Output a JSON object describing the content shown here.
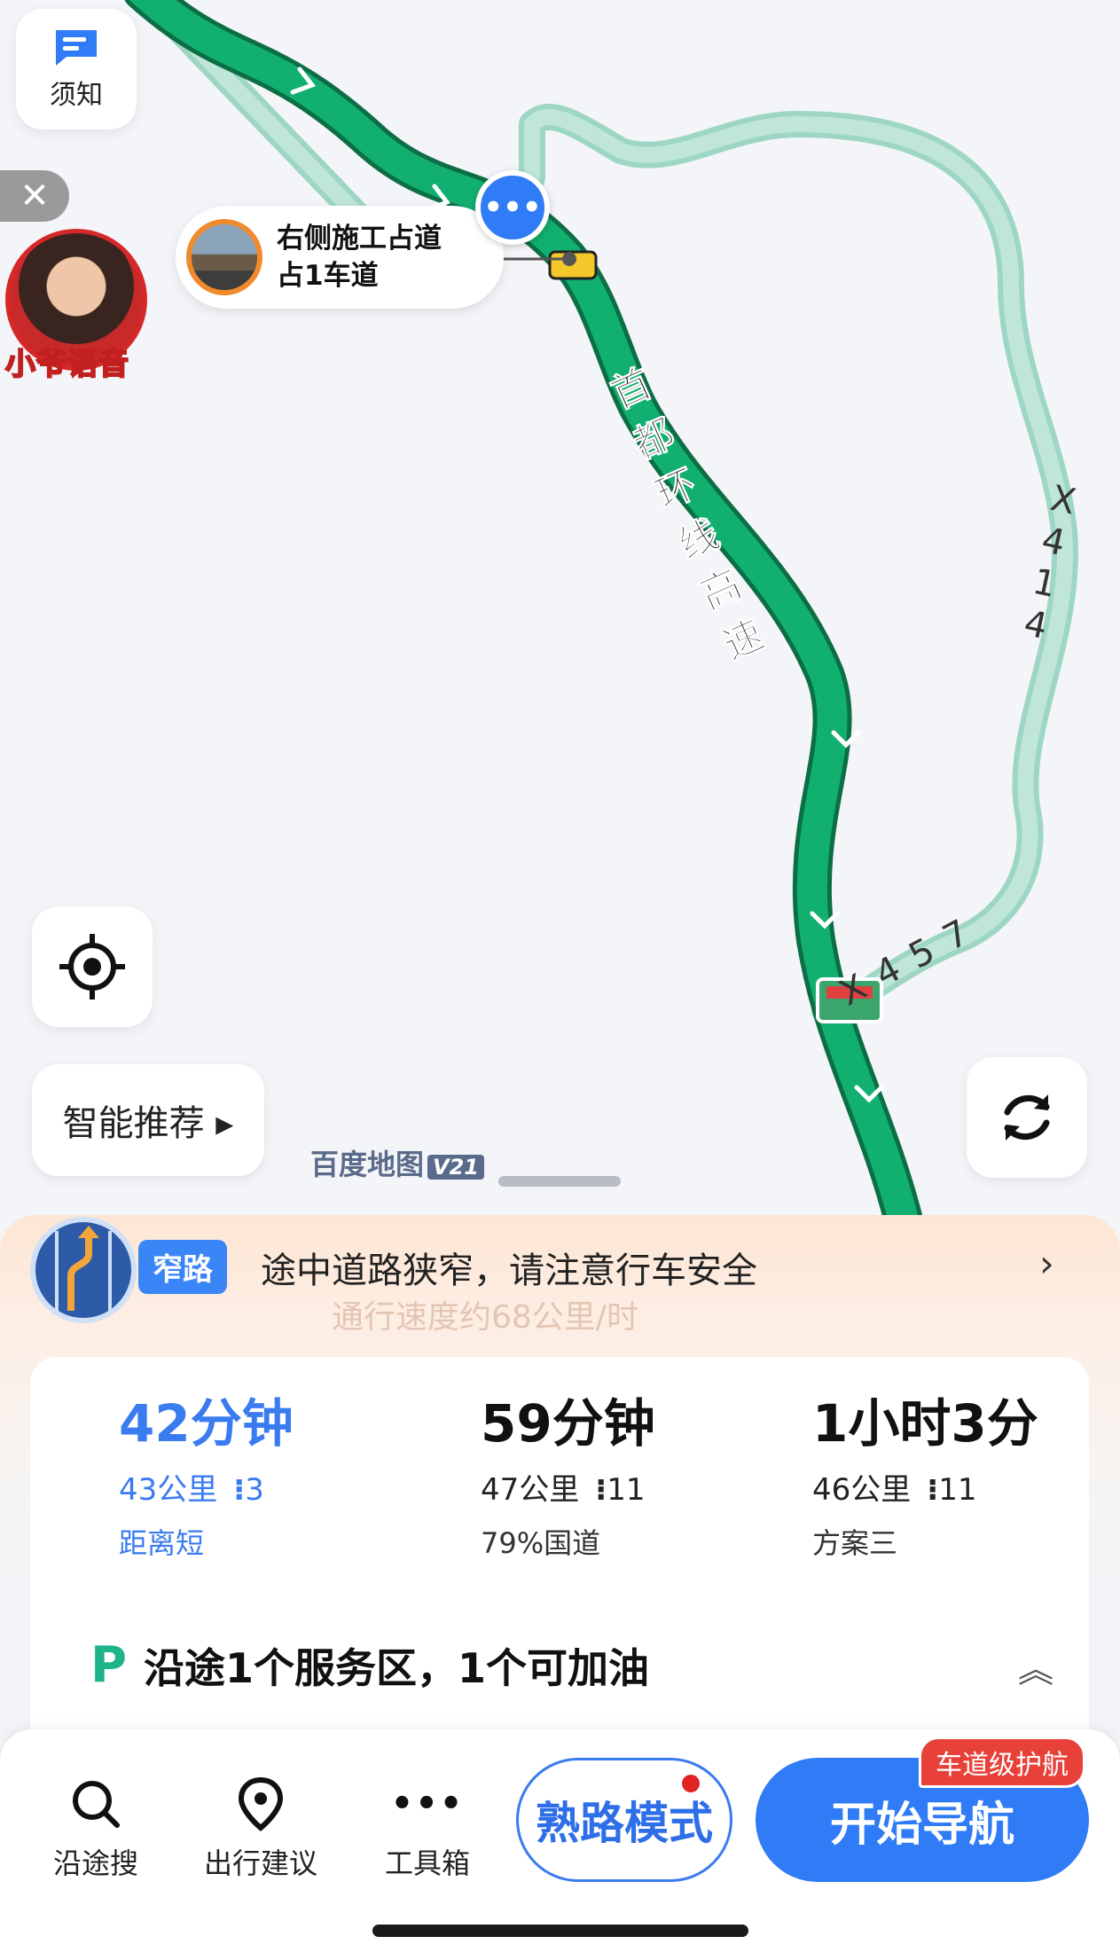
{
  "top_buttons": {
    "notice_label": "须知",
    "close_symbol": "✕"
  },
  "voice": {
    "name": "小爷语音"
  },
  "incident": {
    "line1": "右侧施工占道",
    "line2": "占1车道",
    "bubble_symbol": "•••"
  },
  "map": {
    "main_road_label": "首都环线高速",
    "alt_road_label_1": "X414",
    "alt_road_label_2": "X457",
    "watermark": "百度地图",
    "watermark_version": "V21",
    "route_color": "#0fa86a",
    "alt_route_color": "#9ed6c4"
  },
  "map_controls": {
    "recommend_label": "智能推荐 ▸"
  },
  "alert": {
    "tag": "窄路",
    "text": "途中道路狭窄，请注意行车安全",
    "faded_text": "通行速度约68公里/时",
    "chevron": "›"
  },
  "routes": [
    {
      "time": "42分钟",
      "distance": "43公里",
      "lights": "3",
      "tag": "距离短",
      "selected": true
    },
    {
      "time": "59分钟",
      "distance": "47公里",
      "lights": "11",
      "tag": "79%国道",
      "selected": false
    },
    {
      "time": "1小时3分",
      "distance": "46公里",
      "lights": "11",
      "tag": "方案三",
      "selected": false
    }
  ],
  "service": {
    "text": "沿途1个服务区，1个可加油",
    "caret": "︽"
  },
  "bottom": {
    "search_along": "沿途搜",
    "travel_advice": "出行建议",
    "toolbox": "工具箱",
    "familiar_mode": "熟路模式",
    "start_nav": "开始导航",
    "lane_badge": "车道级护航"
  },
  "colors": {
    "accent": "#2f7cf6",
    "route_green": "#0fa86a",
    "alert_bg": "#fde6d4",
    "badge_red": "#e8413a"
  }
}
